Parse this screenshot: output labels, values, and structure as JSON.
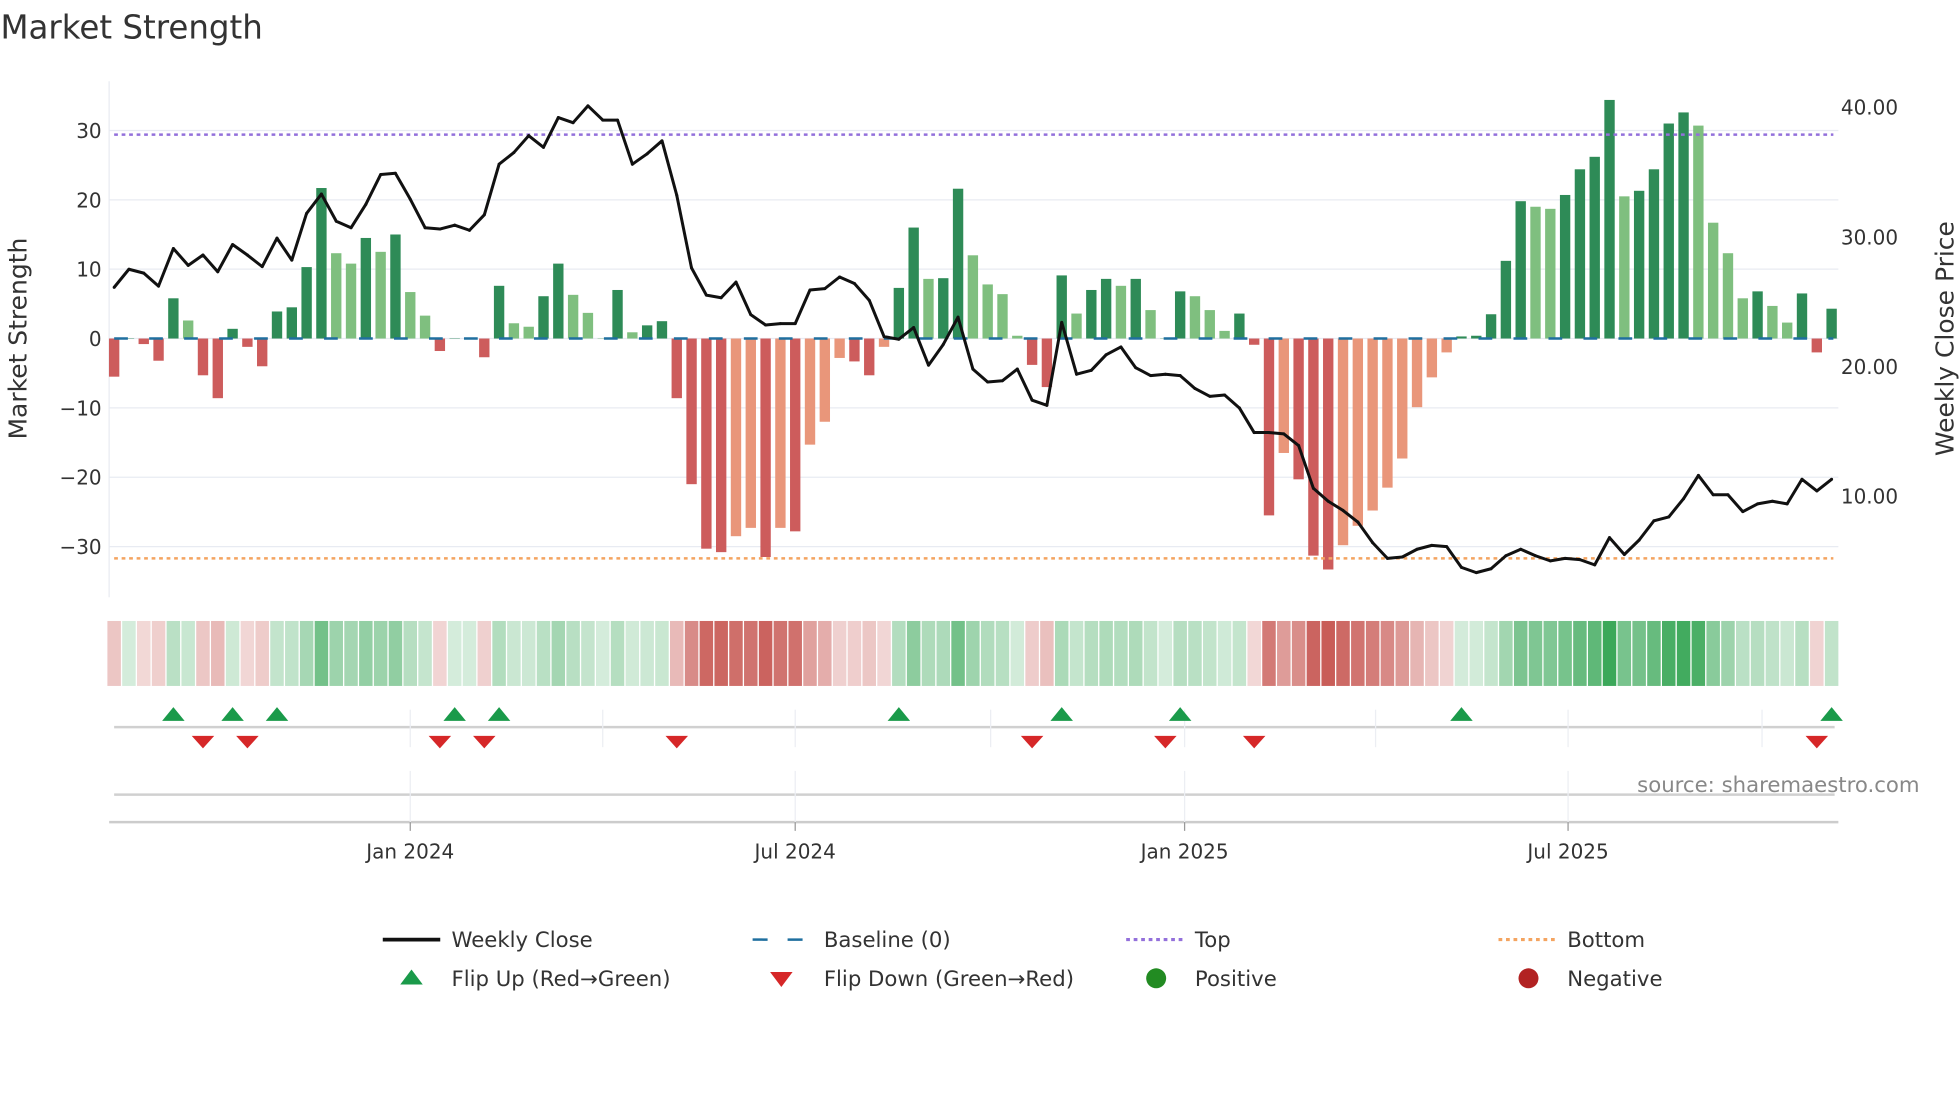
{
  "chart_data": {
    "type": "bar",
    "title": "Market Strength",
    "ylabel": "Market Strength",
    "y2label": "Weekly Close Price",
    "ylim": [
      -37.3,
      37.1
    ],
    "y2lim": [
      2.2,
      42.0
    ],
    "yticks": [
      -30,
      -20,
      -10,
      0,
      10,
      20,
      30
    ],
    "ytick_labels": [
      "−30",
      "−20",
      "−10",
      "0",
      "10",
      "20",
      "30"
    ],
    "y2ticks": [
      10,
      20,
      30,
      40
    ],
    "y2tick_labels": [
      "10.00",
      "20.00",
      "30.00",
      "40.00"
    ],
    "xticks": [
      {
        "week": 20,
        "label": "Jan 2024"
      },
      {
        "week": 46,
        "label": "Jul 2024"
      },
      {
        "week": 72.3,
        "label": "Jan 2025"
      },
      {
        "week": 98.2,
        "label": "Jul 2025"
      }
    ],
    "minor_xgrid_weeks": [
      20,
      33,
      46,
      59.2,
      72.3,
      85.2,
      98.2,
      111.3
    ],
    "grid": true,
    "top_level": 29.4,
    "bottom_level": -31.7,
    "baseline": 0,
    "strength": [
      -5.5,
      0,
      -0.8,
      -3.2,
      5.8,
      2.6,
      -5.3,
      -8.6,
      1.4,
      -1.2,
      -4,
      3.9,
      4.5,
      10.3,
      21.7,
      12.3,
      10.8,
      14.5,
      12.5,
      15,
      6.7,
      3.3,
      -1.8,
      0,
      0,
      -2.7,
      7.6,
      2.2,
      1.7,
      6.1,
      10.8,
      6.3,
      3.7,
      0,
      7,
      0.9,
      1.9,
      2.5,
      -8.6,
      -21,
      -30.3,
      -30.8,
      -28.5,
      -27.3,
      -31.5,
      -27.3,
      -27.8,
      -15.3,
      -12,
      -2.8,
      -3.3,
      -5.3,
      -1.2,
      7.3,
      16,
      8.6,
      8.7,
      21.6,
      12,
      7.8,
      6.4,
      0.4,
      -3.8,
      -7,
      9.1,
      3.6,
      7,
      8.6,
      7.6,
      8.6,
      4.1,
      0,
      6.8,
      6.1,
      4.1,
      1.1,
      3.6,
      -0.9,
      -25.5,
      -16.5,
      -20.3,
      -31.3,
      -33.3,
      -29.8,
      -27,
      -24.8,
      -21.5,
      -17.3,
      -9.9,
      -5.6,
      -2,
      0.3,
      0.4,
      3.5,
      11.2,
      19.8,
      19,
      18.7,
      20.7,
      24.4,
      26.2,
      34.4,
      20.5,
      21.3,
      24.4,
      31,
      32.6,
      30.7,
      16.7,
      12.3,
      5.8,
      6.8,
      4.7,
      2.3,
      6.5,
      -2,
      4.3
    ],
    "weekly_close": [
      26.1,
      27.5,
      27.2,
      26.2,
      29.1,
      27.8,
      28.6,
      27.3,
      29.4,
      28.6,
      27.7,
      29.9,
      28.2,
      31.8,
      33.3,
      31.2,
      30.7,
      32.5,
      34.8,
      34.9,
      32.9,
      30.7,
      30.6,
      30.9,
      30.5,
      31.7,
      35.6,
      36.5,
      37.8,
      36.9,
      39.2,
      38.8,
      40.1,
      39.0,
      39.0,
      35.6,
      36.4,
      37.4,
      33.2,
      27.6,
      25.5,
      25.3,
      26.5,
      24.0,
      23.2,
      23.3,
      23.3,
      25.9,
      26.0,
      26.9,
      26.4,
      25.1,
      22.3,
      22.1,
      23.0,
      20.1,
      21.7,
      23.8,
      19.8,
      18.8,
      18.9,
      19.8,
      17.4,
      17.0,
      23.4,
      19.4,
      19.7,
      20.9,
      21.5,
      19.9,
      19.3,
      19.4,
      19.3,
      18.3,
      17.7,
      17.8,
      16.8,
      14.9,
      14.9,
      14.8,
      13.9,
      10.6,
      9.6,
      8.9,
      8.0,
      6.4,
      5.2,
      5.3,
      5.9,
      6.2,
      6.1,
      4.5,
      4.1,
      4.4,
      5.4,
      5.9,
      5.4,
      5.0,
      5.2,
      5.1,
      4.7,
      6.8,
      5.5,
      6.6,
      8.1,
      8.4,
      9.8,
      11.6,
      10.1,
      10.1,
      8.8,
      9.4,
      9.6,
      9.4,
      11.3,
      10.4,
      11.3
    ],
    "flip_up_weeks": [
      4,
      8,
      11,
      23,
      26,
      53,
      64,
      72,
      91,
      116
    ],
    "flip_down_weeks": [
      6,
      9,
      22,
      25,
      38,
      62,
      71,
      77,
      115
    ],
    "colors": {
      "pos_rising": "#2e8b57",
      "pos_falling": "#7fbf7f",
      "neg_falling": "#cd5c5c",
      "neg_rising": "#e9967a",
      "close": "#111111",
      "baseline": "#1f6f9f",
      "top": "#9370db",
      "bottom": "#f4a460",
      "flip_up": "#1a9a4a",
      "flip_down": "#d62728",
      "positive": "#228b22",
      "negative": "#b22222",
      "grid": "#e8ebf2"
    },
    "legend": [
      {
        "key": "close",
        "label": "Weekly Close"
      },
      {
        "key": "baseline",
        "label": "Baseline (0)"
      },
      {
        "key": "top",
        "label": "Top"
      },
      {
        "key": "bottom",
        "label": "Bottom"
      },
      {
        "key": "flip_up",
        "label": "Flip Up (Red→Green)"
      },
      {
        "key": "flip_down",
        "label": "Flip Down (Green→Red)"
      },
      {
        "key": "positive",
        "label": "Positive"
      },
      {
        "key": "negative",
        "label": "Negative"
      }
    ],
    "legend_placement": "bottom",
    "source": "source: sharemaestro.com"
  }
}
